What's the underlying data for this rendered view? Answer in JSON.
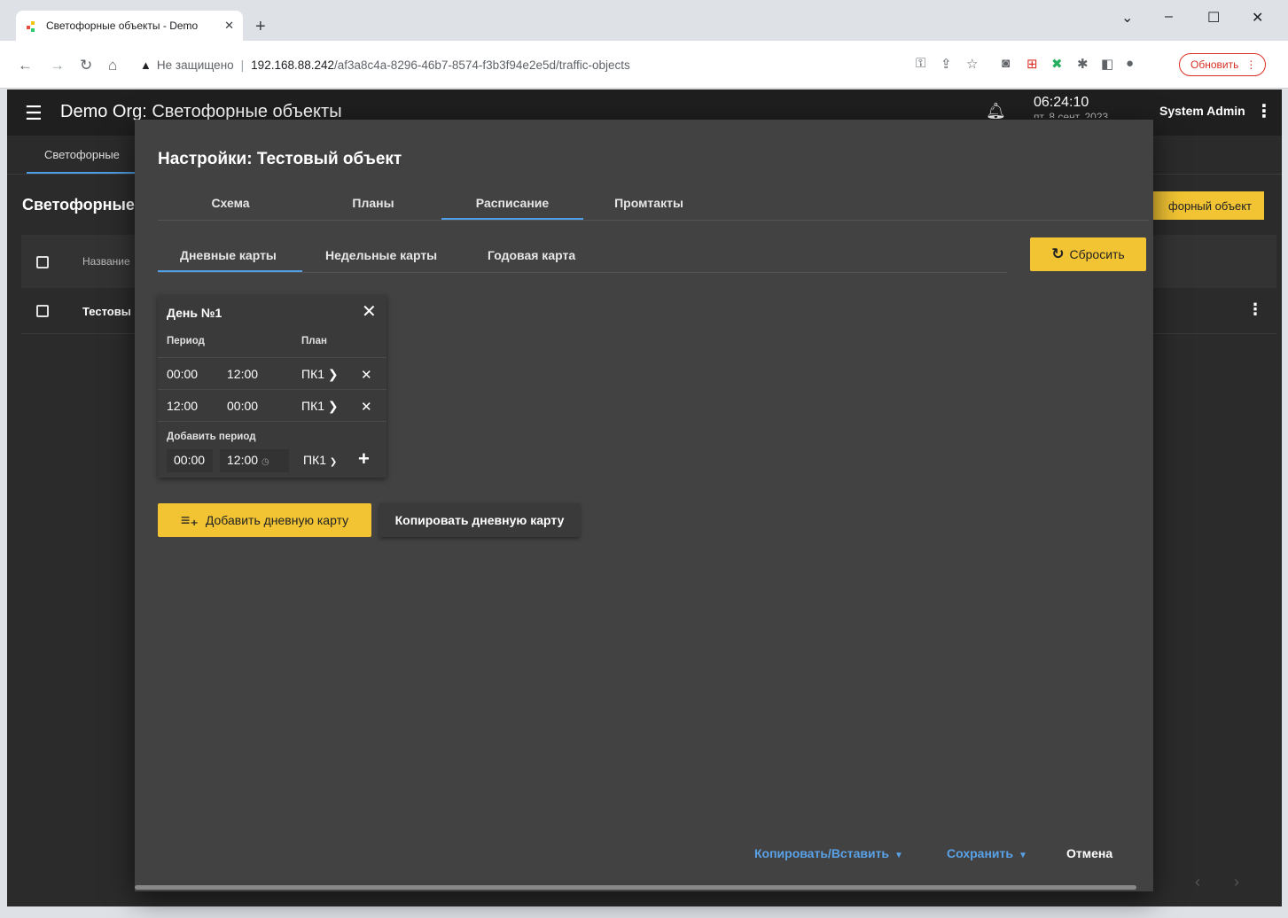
{
  "browser": {
    "tab_title": "Светофорные объекты - Demo",
    "tab_close": "✕",
    "new_tab": "+",
    "win_min": "–",
    "win_max": "☐",
    "win_close": "✕",
    "win_dropdown": "⌄",
    "url_warning": "Не защищено",
    "url_host": "192.168.88.242",
    "url_path": "/af3a8c4a-8296-46b7-8574-f3b3f94e2e5d/traffic-objects",
    "update_label": "Обновить"
  },
  "app": {
    "title": "Demo Org: Светофорные объекты",
    "time": "06:24:10",
    "date": "пт, 8 сент. 2023",
    "user": "System Admin",
    "nav_tab": "Светофорные",
    "page_title": "Светофорные",
    "add_object_label": "форный объект",
    "table_header_name": "Название",
    "row_name": "Тестовы"
  },
  "dialog": {
    "title": "Настройки: Тестовый объект",
    "tabs": [
      "Схема",
      "Планы",
      "Расписание",
      "Промтакты"
    ],
    "subtabs": [
      "Дневные карты",
      "Недельные карты",
      "Годовая карта"
    ],
    "reset_label": "Сбросить",
    "day_card": {
      "title": "День №1",
      "col_period": "Период",
      "col_plan": "План",
      "periods": [
        {
          "from": "00:00",
          "to": "12:00",
          "plan": "ПК1"
        },
        {
          "from": "12:00",
          "to": "00:00",
          "plan": "ПК1"
        }
      ],
      "add_label": "Добавить период",
      "add_from": "00:00",
      "add_to": "12:00",
      "add_plan": "ПК1"
    },
    "add_day_label": "Добавить дневную карту",
    "copy_day_label": "Копировать дневную карту",
    "copy_paste_label": "Копировать/Вставить",
    "save_label": "Сохранить",
    "cancel_label": "Отмена"
  },
  "colors": {
    "accent": "#f2c433",
    "link": "#5aa2e8",
    "tab_ink": "#4f9ee6",
    "dialog_bg": "#424242"
  }
}
